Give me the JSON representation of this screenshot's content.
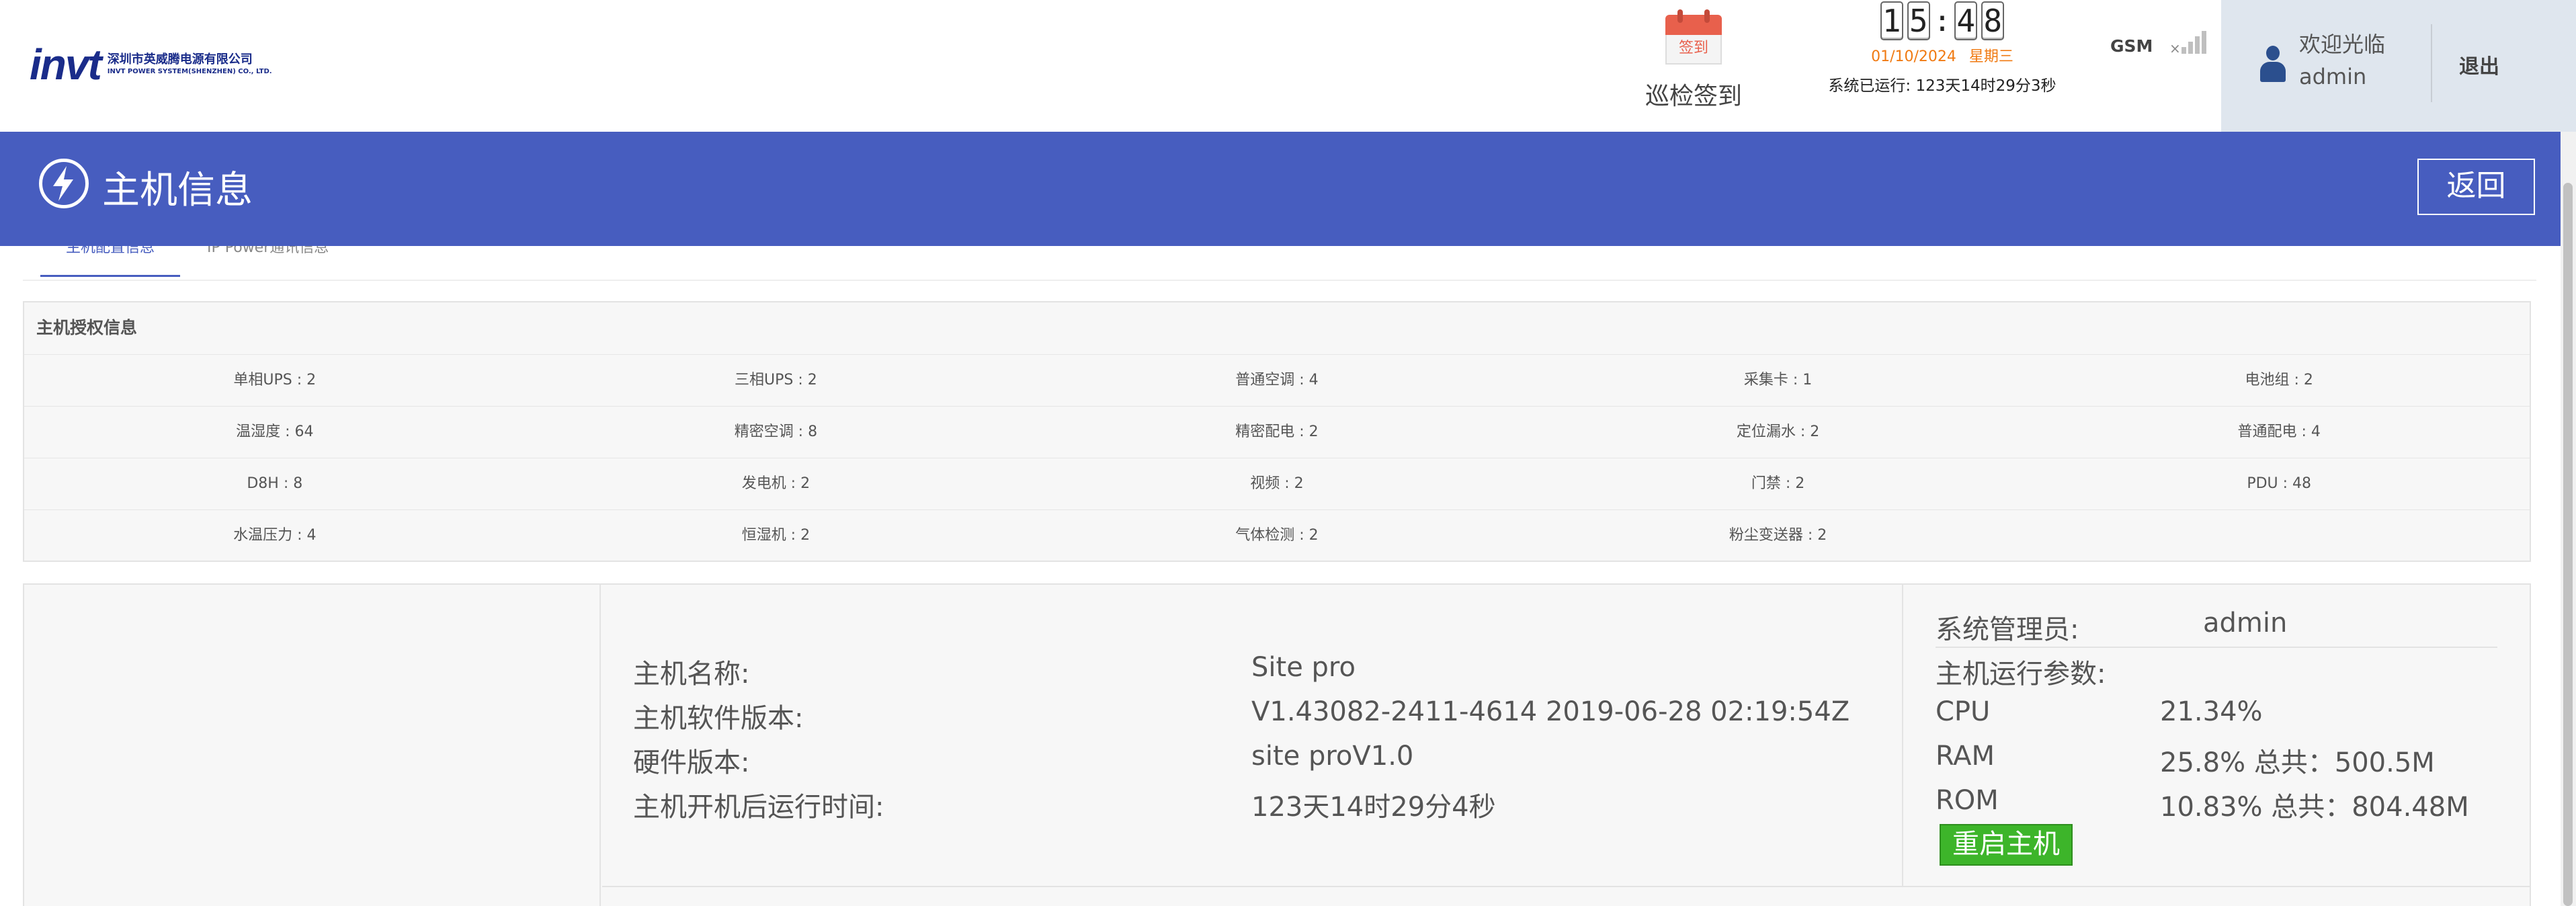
{
  "header": {
    "logo": {
      "mark": "invt",
      "company_cn": "深圳市英威腾电源有限公司",
      "company_en": "INVT POWER SYSTEM(SHENZHEN) CO., LTD."
    },
    "signin": {
      "badge": "签到",
      "label": "巡检签到",
      "icon": "calendar-icon"
    },
    "clock": {
      "h1": "1",
      "h2": "5",
      "m1": "4",
      "m2": "8",
      "colon": ":",
      "date": "01/10/2024",
      "weekday": "星期三",
      "uptime": "系统已运行: 123天14时29分3秒"
    },
    "gsm": {
      "label": "GSM",
      "icon": "signal-bars-icon",
      "signal_level": 0,
      "disconnected_mark": "×"
    },
    "user": {
      "welcome": "欢迎光临",
      "name": "admin",
      "logout": "退出",
      "icon": "user-icon"
    }
  },
  "titlebar": {
    "title": "主机信息",
    "back": "返回",
    "icon": "lightning-icon",
    "color": "#475dbf"
  },
  "tabs": [
    {
      "label": "主机配置信息",
      "active": true
    },
    {
      "label": "IP Power通讯信息",
      "active": false
    }
  ],
  "auth": {
    "heading": "主机授权信息",
    "rows": [
      [
        "单相UPS : 2",
        "三相UPS : 2",
        "普通空调 : 4",
        "采集卡 : 1",
        "电池组 : 2"
      ],
      [
        "温湿度 : 64",
        "精密空调 : 8",
        "精密配电 : 2",
        "定位漏水 : 2",
        "普通配电 : 4"
      ],
      [
        "D8H : 8",
        "发电机 : 2",
        "视频 : 2",
        "门禁 : 2",
        "PDU : 48"
      ],
      [
        "水温压力 : 4",
        "恒湿机 : 2",
        "气体检测 : 2",
        "粉尘变送器 : 2",
        ""
      ]
    ]
  },
  "host": {
    "name_label": "主机名称:",
    "name_value": "Site pro",
    "sw_label": "主机软件版本:",
    "sw_value": "V1.43082-2411-4614 2019-06-28 02:19:54Z",
    "hw_label": "硬件版本:",
    "hw_value": "site proV1.0",
    "run_label": "主机开机后运行时间:",
    "run_value": "123天14时29分4秒",
    "admin_label": "系统管理员:",
    "admin_value": "admin",
    "params_label": "主机运行参数:",
    "cpu_label": "CPU",
    "cpu_value": "21.34%",
    "ram_label": "RAM",
    "ram_value": "25.8%  总共：500.5M",
    "rom_label": "ROM",
    "rom_value": "10.83%  总共：804.48M",
    "reboot": "重启主机",
    "reboot_color": "#3db52a"
  }
}
